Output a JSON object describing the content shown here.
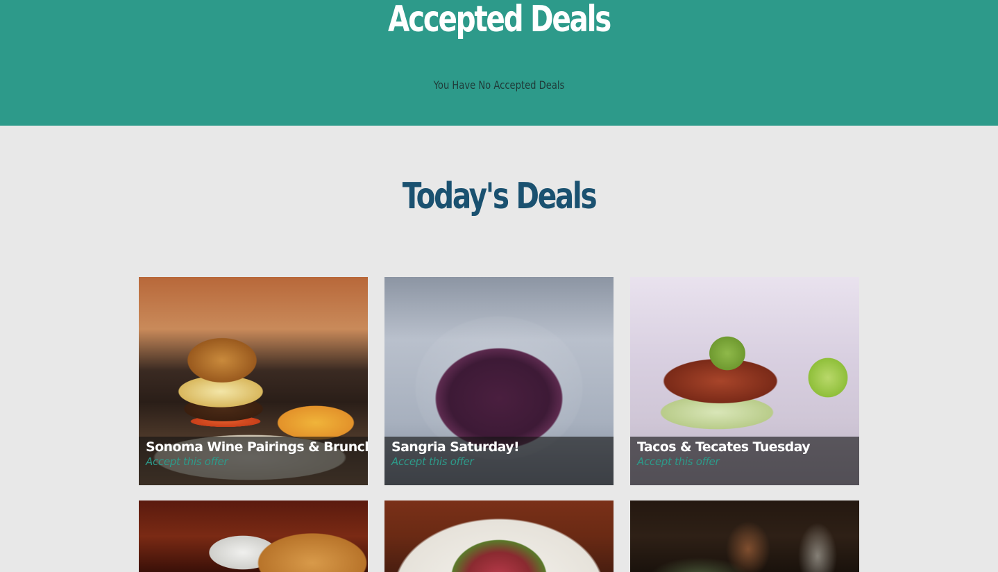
{
  "accepted": {
    "title": "Accepted Deals",
    "empty_message": "You Have No Accepted Deals"
  },
  "today": {
    "title": "Today's Deals",
    "deals": [
      {
        "title": "Sonoma Wine Pairings & Brunch",
        "action": "Accept this offer",
        "photo": "burger-and-fries-photo"
      },
      {
        "title": "Sangria Saturday!",
        "action": "Accept this offer",
        "photo": "sangria-glass-photo"
      },
      {
        "title": "Tacos & Tecates Tuesday",
        "action": "Accept this offer",
        "photo": "fish-taco-photo"
      },
      {
        "photo": "pastry-dessert-photo"
      },
      {
        "photo": "salad-plate-photo"
      },
      {
        "photo": "bar-drinks-photo"
      }
    ]
  },
  "colors": {
    "accepted_bg": "#2d9a8a",
    "page_bg": "#e8e8e8",
    "today_title": "#1a5170",
    "accept_link": "#2d9a8a"
  }
}
